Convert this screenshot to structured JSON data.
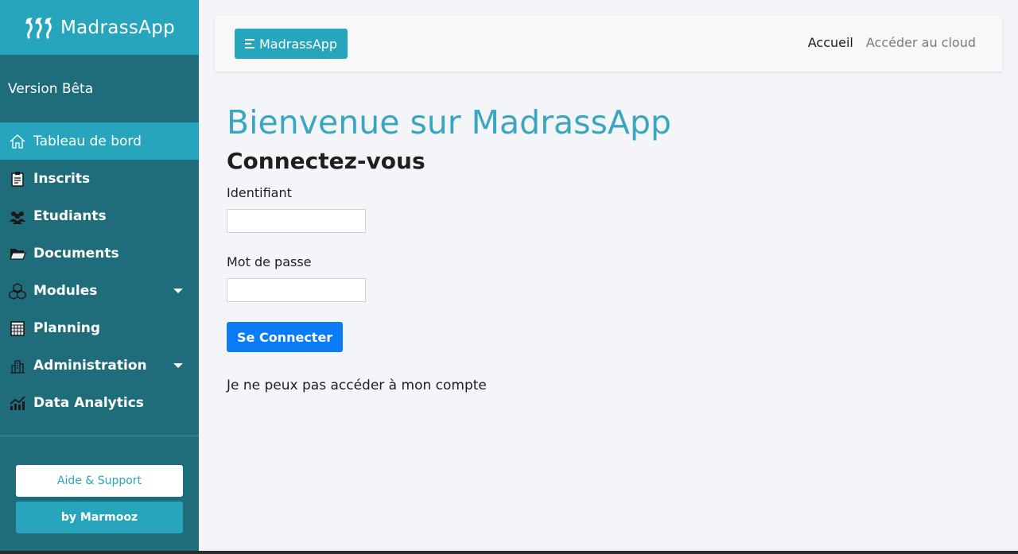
{
  "sidebar": {
    "brand": "MadrassApp",
    "version": "Version Bêta",
    "items": [
      {
        "label": "Tableau de bord",
        "icon": "home-icon"
      },
      {
        "label": "Inscrits",
        "icon": "clipboard-icon"
      },
      {
        "label": "Etudiants",
        "icon": "users-icon"
      },
      {
        "label": "Documents",
        "icon": "folder-icon"
      },
      {
        "label": "Modules",
        "icon": "cubes-icon"
      },
      {
        "label": "Planning",
        "icon": "calendar-icon"
      },
      {
        "label": "Administration",
        "icon": "building-icon"
      },
      {
        "label": "Data Analytics",
        "icon": "chart-icon"
      }
    ],
    "help_button": "Aide & Support",
    "by_button": "by Marmooz"
  },
  "topbar": {
    "toggle_label": "MadrassApp",
    "links": {
      "home": "Accueil",
      "cloud": "Accéder au cloud"
    }
  },
  "main": {
    "title": "Bienvenue sur MadrassApp",
    "subtitle": "Connectez-vous",
    "username_label": "Identifiant",
    "password_label": "Mot de passe",
    "submit_label": "Se Connecter",
    "forgot_link": "Je ne peux pas accéder à mon compte"
  },
  "colors": {
    "sidebar": "#1f6c7a",
    "accent": "#27a5bc",
    "primary_button": "#0a7cf8",
    "title": "#3aa6bf",
    "background": "#f4f5f9"
  }
}
